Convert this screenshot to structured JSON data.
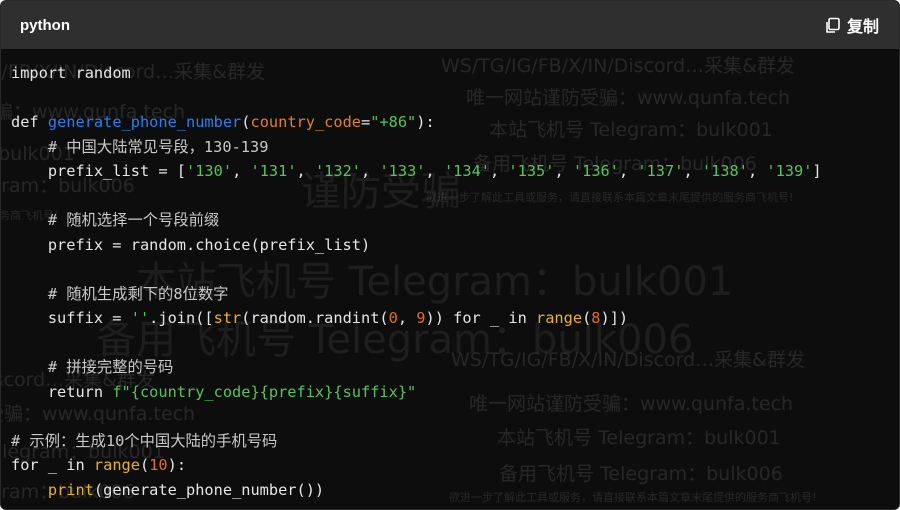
{
  "header": {
    "language": "python",
    "copy_label": "复制",
    "copy_icon": "copy-icon"
  },
  "watermark": {
    "line1": "WS/TG/IG/FB/X/IN/Discord…采集&群发",
    "line2": "唯一网站谨防受骗：www.qunfa.tech",
    "line3": "本站飞机号 Telegram：bulk001",
    "line4": "备用飞机号 Telegram：bulk006",
    "line5": "欲进一步了解此工具或服务，请直接联系本篇文章末尾提供的服务商飞机号!",
    "big1": "谨防受骗",
    "big2": "本站飞机号 Telegram：bulk001",
    "big3": "备用飞机号 Telegram：bulk006"
  },
  "code": {
    "l1_kw": "import",
    "l1_mod": "random",
    "l3_kw": "def",
    "l3_fn": "generate_phone_number",
    "l3_param": "country_code",
    "l3_default": "\"+86\"",
    "l4_comment": "# 中国大陆常见号段，130-139",
    "l5_var": "prefix_list",
    "l5_items": [
      "'130'",
      "'131'",
      "'132'",
      "'133'",
      "'134'",
      "'135'",
      "'136'",
      "'137'",
      "'138'",
      "'139'"
    ],
    "l7_comment": "# 随机选择一个号段前缀",
    "l8_text": "prefix = random.choice(prefix_list)",
    "l10_comment": "# 随机生成剩下的8位数字",
    "l11_a": "suffix = ",
    "l11_str": "''",
    "l11_b": ".join([",
    "l11_str_fn": "str",
    "l11_c": "(random.randint(",
    "l11_n0": "0",
    "l11_d": ", ",
    "l11_n9": "9",
    "l11_e": ")) for _ in ",
    "l11_range": "range",
    "l11_f": "(",
    "l11_n8": "8",
    "l11_g": ")])",
    "l13_comment": "# 拼接完整的号码",
    "l14_kw": "return",
    "l14_fstr": "f\"{country_code}{prefix}{suffix}\"",
    "l16_comment": "# 示例：生成10个中国大陆的手机号码",
    "l17_kw": "for",
    "l17_a": " _ in ",
    "l17_range": "range",
    "l17_b": "(",
    "l17_n": "10",
    "l17_c": "):",
    "l18_print": "print",
    "l18_rest": "(generate_phone_number())"
  }
}
